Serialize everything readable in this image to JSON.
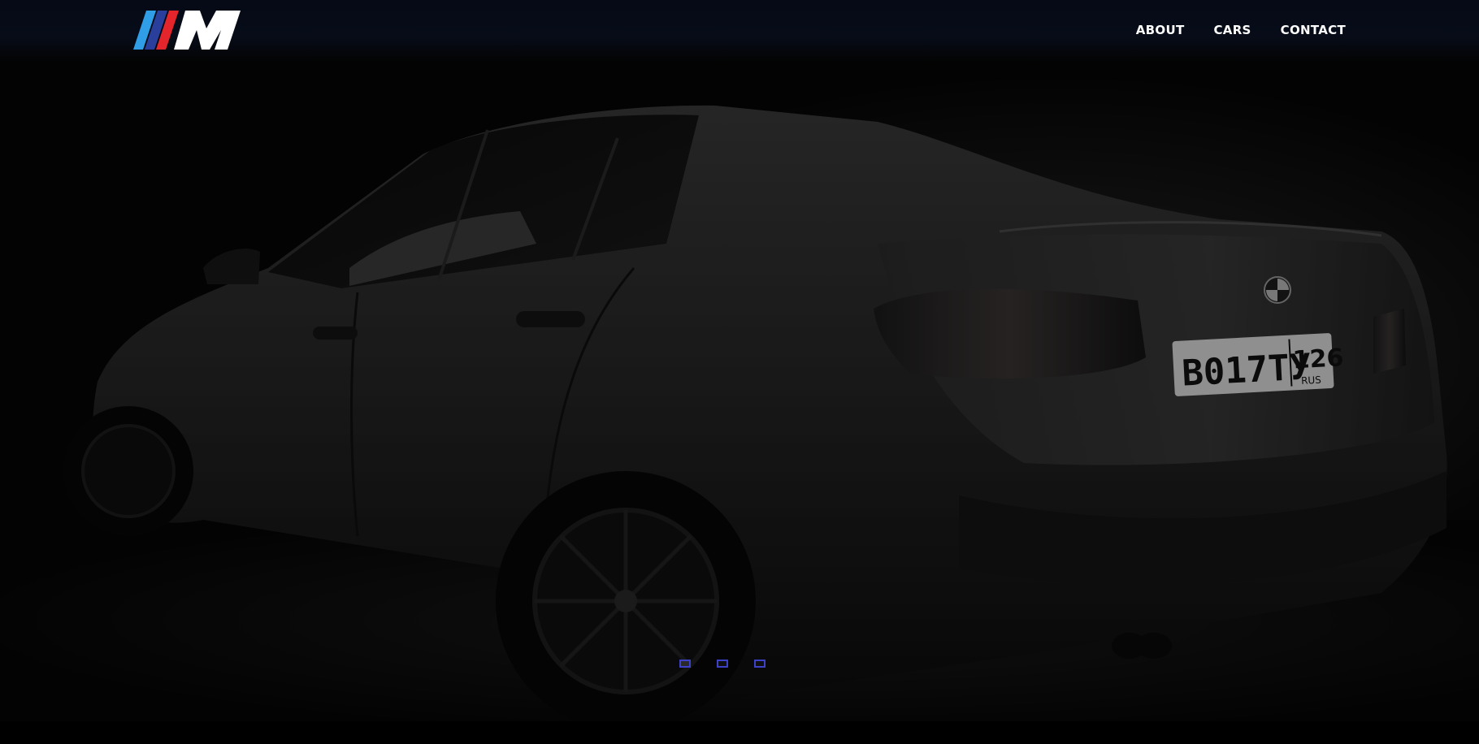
{
  "brand": {
    "logo_icon": "m-stripes-logo",
    "stripe_colors": [
      "#2f9ee6",
      "#2a3f9c",
      "#e4262c"
    ],
    "letter_color": "#ffffff"
  },
  "nav": {
    "items": [
      {
        "label": "ABOUT"
      },
      {
        "label": "CARS"
      },
      {
        "label": "CONTACT"
      }
    ]
  },
  "hero": {
    "image": "dark-bmw-sedan-rear-three-quarter",
    "plate_main": "В017ТУ",
    "plate_region": "126",
    "plate_country": "RUS"
  },
  "carousel": {
    "slide_count": 3,
    "active_index": 0,
    "dot_color": "#3d41c7"
  }
}
